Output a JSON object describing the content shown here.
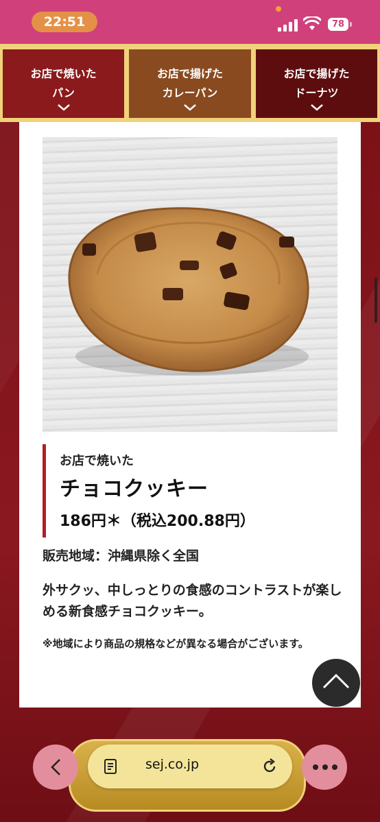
{
  "status_bar": {
    "time": "22:51",
    "battery": "78"
  },
  "categories": [
    {
      "line1": "お店で焼いた",
      "line2": "パン"
    },
    {
      "line1": "お店で揚げた",
      "line2": "カレーパン"
    },
    {
      "line1": "お店で揚げた",
      "line2": "ドーナツ"
    }
  ],
  "product": {
    "subtitle": "お店で焼いた",
    "name": "チョコクッキー",
    "price": "186円＊（税込200.88円）",
    "region": "販売地域：沖縄県除く全国",
    "description": "外サクッ、中しっとりの食感のコントラストが楽しめる新食感チョコクッキー。",
    "note": "※地域により商品の規格などが異なる場合がございます。"
  },
  "browser": {
    "domain": "sej.co.jp"
  },
  "colors": {
    "accent": "#b01e24",
    "status_bar": "#d0417b",
    "gold": "#f0d27a"
  }
}
